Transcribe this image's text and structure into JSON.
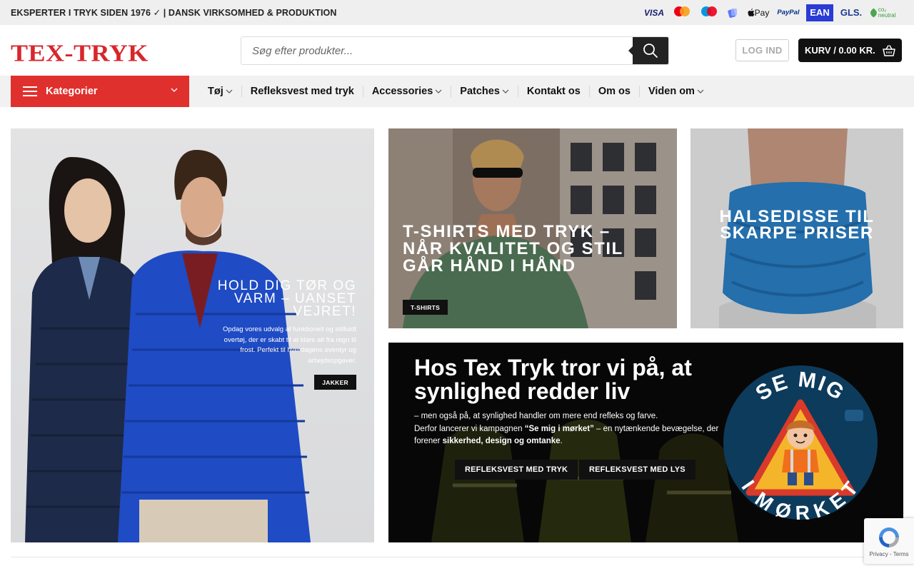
{
  "topbar": {
    "tagline": "EKSPERTER I TRYK SIDEN 1976 ✓ | DANSK VIRKSOMHED & PRODUKTION",
    "payment_labels": {
      "visa": "VISA",
      "applepay": "Pay",
      "paypal": "PayPal",
      "ean": "EAN",
      "gls": "GLS.",
      "coneutral": "co₂ neutral"
    }
  },
  "header": {
    "logo": "TEX-TRYK",
    "search_placeholder": "Søg efter produkter...",
    "login_label": "LOG IND",
    "cart_label": "KURV / 0.00 KR."
  },
  "nav": {
    "categories_label": "Kategorier",
    "items": [
      {
        "label": "Tøj",
        "dropdown": true
      },
      {
        "label": "Refleksvest med tryk",
        "dropdown": false
      },
      {
        "label": "Accessories",
        "dropdown": true
      },
      {
        "label": "Patches",
        "dropdown": true
      },
      {
        "label": "Kontakt os",
        "dropdown": false
      },
      {
        "label": "Om os",
        "dropdown": false
      },
      {
        "label": "Viden om",
        "dropdown": true
      }
    ]
  },
  "banners": {
    "jakker": {
      "title": "HOLD DIG TØR OG VARM – UANSET VEJRET!",
      "description": "Opdag vores udvalg af funktionelt og stilfuldt overtøj, der er skabt til at klare alt fra regn til frost. Perfekt til hverdagens eventyr og arbejdsopgaver.",
      "button": "JAKKER"
    },
    "tshirts": {
      "title": "T-SHIRTS MED TRYK – NÅR KVALITET OG STIL GÅR HÅND I HÅND",
      "button": "T-SHIRTS"
    },
    "halsedisse": {
      "title": "HALSEDISSE TIL SKARPE PRISER"
    },
    "refleks": {
      "title": "Hos Tex Tryk tror vi på, at synlighed redder liv",
      "line1": "– men også på, at synlighed handler om mere end refleks og farve.",
      "line2_a": "Derfor lancerer vi kampagnen ",
      "line2_campaign": "“Se mig i mørket”",
      "line2_b": " – en nytænkende bevægelse, der forener ",
      "line2_bold": "sikkerhed, design og omtanke",
      "line2_end": ".",
      "button1": "REFLEKSVEST MED TRYK",
      "button2": "REFLEKSVEST MED LYS",
      "badge_top": "SE MIG",
      "badge_bottom": "I MØRKET"
    }
  },
  "recaptcha": {
    "label": "Privacy - Terms"
  },
  "colors": {
    "brand_red": "#d8262c",
    "category_red": "#e0302d",
    "dark": "#111111",
    "topbar_bg": "#efefef",
    "nav_bg": "#f1f1f1"
  }
}
